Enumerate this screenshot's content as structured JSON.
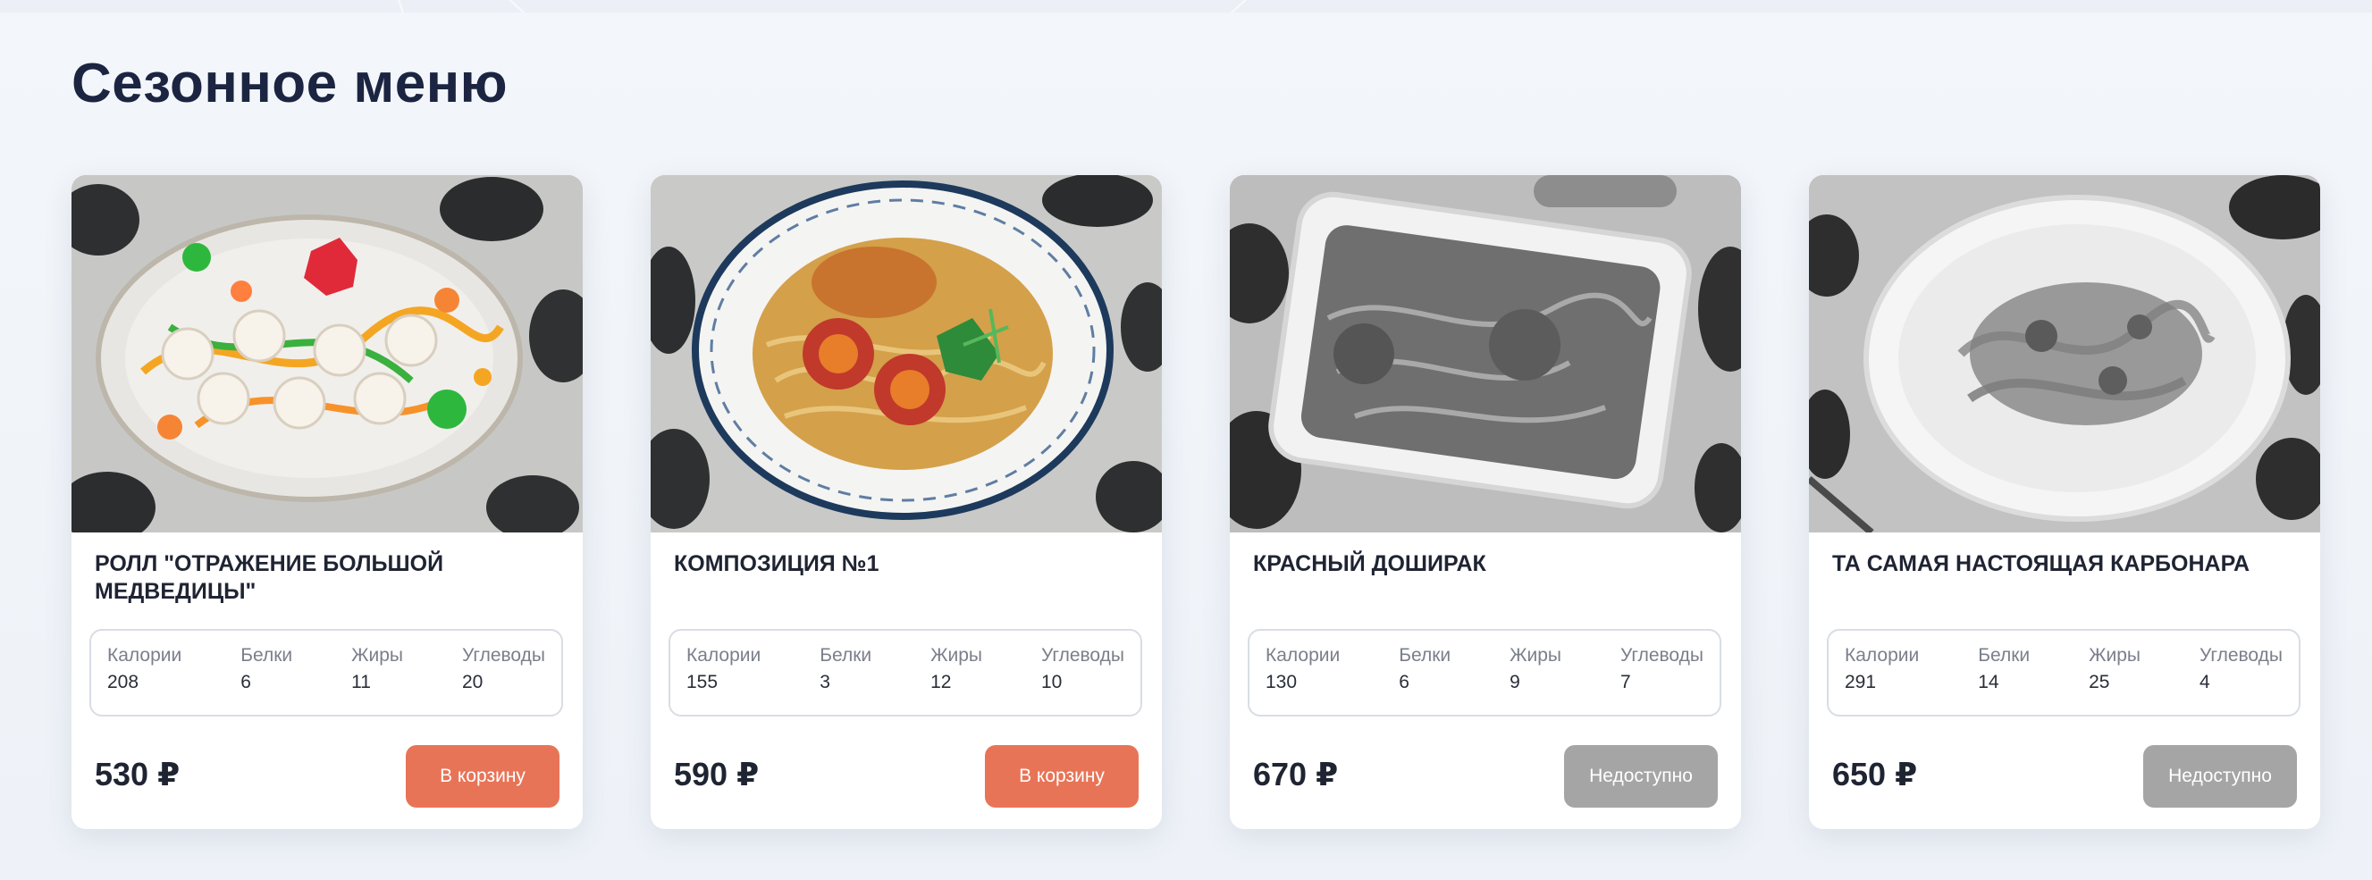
{
  "section": {
    "title": "Сезонное меню"
  },
  "nutrition_labels": {
    "calories": "Калории",
    "protein": "Белки",
    "fat": "Жиры",
    "carbs": "Углеводы"
  },
  "cards": [
    {
      "name": "РОЛЛ \"ОТРАЖЕНИЕ БОЛЬШОЙ МЕДВЕДИЦЫ\"",
      "calories": "208",
      "protein": "6",
      "fat": "11",
      "carbs": "20",
      "price": "530 ₽",
      "button": "В корзину",
      "available": true
    },
    {
      "name": "КОМПОЗИЦИЯ №1",
      "calories": "155",
      "protein": "3",
      "fat": "12",
      "carbs": "10",
      "price": "590 ₽",
      "button": "В корзину",
      "available": true
    },
    {
      "name": "КРАСНЫЙ ДОШИРАК",
      "calories": "130",
      "protein": "6",
      "fat": "9",
      "carbs": "7",
      "price": "670 ₽",
      "button": "Недоступно",
      "available": false
    },
    {
      "name": "ТА САМАЯ НАСТОЯЩАЯ КАРБОНАРА",
      "calories": "291",
      "protein": "14",
      "fat": "25",
      "carbs": "4",
      "price": "650 ₽",
      "button": "Недоступно",
      "available": false
    }
  ],
  "colors": {
    "accent_button": "#e87457",
    "disabled_button": "#a5a5a5",
    "title_text": "#1b2440"
  }
}
